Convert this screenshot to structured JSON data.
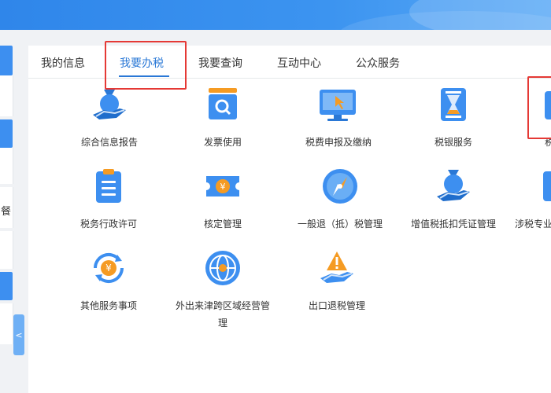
{
  "tabs": [
    {
      "label": "我的信息"
    },
    {
      "label": "我要办税",
      "active": true
    },
    {
      "label": "我要查询"
    },
    {
      "label": "互动中心"
    },
    {
      "label": "公众服务"
    }
  ],
  "left_panel": {
    "glyph": "餐",
    "collapse_glyph": "<"
  },
  "services": [
    {
      "label": "综合信息报告",
      "icon": "money-bag-hand-icon"
    },
    {
      "label": "发票使用",
      "icon": "invoice-search-icon"
    },
    {
      "label": "税费申报及缴纳",
      "icon": "monitor-cursor-icon"
    },
    {
      "label": "税银服务",
      "icon": "hourglass-icon"
    },
    {
      "label": "税",
      "icon": "partial-service-icon"
    },
    {
      "label": "税务行政许可",
      "icon": "clipboard-icon"
    },
    {
      "label": "核定管理",
      "icon": "ticket-yen-icon"
    },
    {
      "label": "一般退（抵）税管理",
      "icon": "compass-icon"
    },
    {
      "label": "增值税抵扣凭证管理",
      "icon": "money-bag-hand-icon"
    },
    {
      "label": "涉税专业",
      "icon": "partial-service-icon"
    },
    {
      "label": "其他服务事项",
      "icon": "yen-cycle-icon"
    },
    {
      "label_line1": "外出来津跨区域经营管",
      "label_line2": "理",
      "icon": "globe-icon"
    },
    {
      "label": "出口退税管理",
      "icon": "warning-hand-icon"
    }
  ],
  "colors": {
    "brand_blue": "#3d8ff0",
    "active_tab": "#2a78d6",
    "highlight_red": "#e53935"
  }
}
